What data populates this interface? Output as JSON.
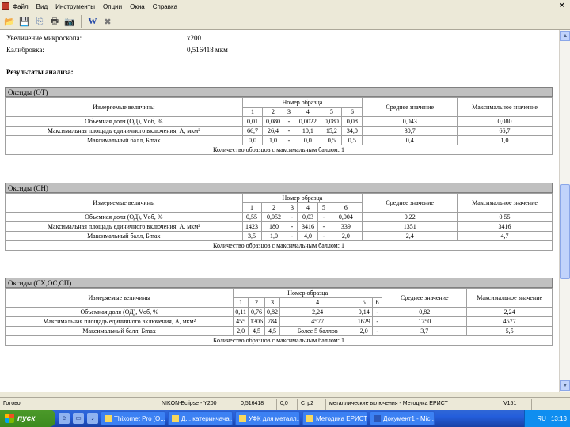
{
  "menu": {
    "items": [
      "Файл",
      "Вид",
      "Инструменты",
      "Опции",
      "Окна",
      "Справка"
    ]
  },
  "toolbar": {
    "icons": [
      "open-icon",
      "save-icon",
      "copy-icon",
      "print-icon",
      "camera-icon",
      "word-icon",
      "excel-icon"
    ],
    "word_glyph": "W",
    "excel_glyph": "✖"
  },
  "info": {
    "magnification_label": "Увеличение микроскопа:",
    "magnification_value": "x200",
    "calibration_label": "Калибровка:",
    "calibration_value": "0,516418 мкм",
    "results_label": "Результаты анализа:"
  },
  "sections": [
    {
      "title": "Оксиды (ОТ)",
      "header": {
        "quantity": "Измеряемые величины",
        "sample_no": "Номер образца",
        "cols": [
          "1",
          "2",
          "3",
          "4",
          "5",
          "6"
        ],
        "mean": "Среднее значение",
        "max": "Максимальное значение"
      },
      "rows": [
        {
          "label": "Объемная доля (ОД), Vоб, %",
          "cells": [
            "0,01",
            "0,080",
            "-",
            "0,0022",
            "0,080",
            "0,08"
          ],
          "mean": "0,043",
          "max": "0,080"
        },
        {
          "label": "Максимальная площадь единичного включения, A, мкм²",
          "cells": [
            "66,7",
            "26,4",
            "-",
            "10,1",
            "15,2",
            "34,0"
          ],
          "mean": "30,7",
          "max": "66,7"
        },
        {
          "label": "Максимальный балл, Бmax",
          "cells": [
            "0,0",
            "1,0",
            "-",
            "0,0",
            "0,5",
            "0,5"
          ],
          "mean": "0,4",
          "max": "1,0"
        }
      ],
      "footer": "Количество образцов с максимальным баллом: 1"
    },
    {
      "title": "Оксиды (СН)",
      "header": {
        "quantity": "Измеряемые величины",
        "sample_no": "Номер образца",
        "cols": [
          "1",
          "2",
          "3",
          "4",
          "5",
          "6"
        ],
        "mean": "Среднее значение",
        "max": "Максимальное значение"
      },
      "rows": [
        {
          "label": "Объемная доля (ОД), Vоб, %",
          "cells": [
            "0,55",
            "0,052",
            "-",
            "0,03",
            "-",
            "0,004"
          ],
          "mean": "0,22",
          "max": "0,55"
        },
        {
          "label": "Максимальная площадь единичного включения, A, мкм²",
          "cells": [
            "1423",
            "180",
            "-",
            "3416",
            "-",
            "339"
          ],
          "mean": "1351",
          "max": "3416"
        },
        {
          "label": "Максимальный балл, Бmax",
          "cells": [
            "3,5",
            "1,0",
            "-",
            "4,0",
            "-",
            "2,0"
          ],
          "mean": "2,4",
          "max": "4,7"
        }
      ],
      "footer": "Количество образцов с максимальным баллом: 1"
    },
    {
      "title": "Оксиды (СХ,ОС,СП)",
      "header": {
        "quantity": "Измеряемые величины",
        "sample_no": "Номер образца",
        "cols": [
          "1",
          "2",
          "3",
          "4",
          "5",
          "6"
        ],
        "mean": "Среднее значение",
        "max": "Максимальное значение"
      },
      "rows": [
        {
          "label": "Объемная доля (ОД), Vоб, %",
          "cells": [
            "0,11",
            "0,76",
            "0,82",
            "2,24",
            "0,14",
            "-"
          ],
          "mean": "0,82",
          "max": "2,24"
        },
        {
          "label": "Максимальная площадь единичного включения, A, мкм²",
          "cells": [
            "455",
            "1306",
            "784",
            "4577",
            "1629",
            "-"
          ],
          "mean": "1750",
          "max": "4577"
        },
        {
          "label": "Максимальный балл, Бmax",
          "cells": [
            "2,0",
            "4,5",
            "4,5",
            "Более 5 баллов",
            "2,0",
            "-"
          ],
          "mean": "3,7",
          "max": "5,5"
        }
      ],
      "footer": "Количество образцов с максимальным баллом: 1"
    }
  ],
  "statusbar": {
    "cells": [
      "Готово",
      "NIKON-Eclipse - Y200",
      "0,516418",
      "0,0",
      "Стр2",
      "металлические включения - Методика ЕРИСТ",
      "V151",
      ""
    ]
  },
  "taskbar": {
    "start": "пуск",
    "tasks": [
      "Thixomet Pro [O...",
      "Д...  катеринчача...",
      "УФК для металл...",
      "Методика ЕРИСТ...",
      "Документ1 - Mic..."
    ],
    "lang": "RU",
    "clock": "13:13"
  }
}
